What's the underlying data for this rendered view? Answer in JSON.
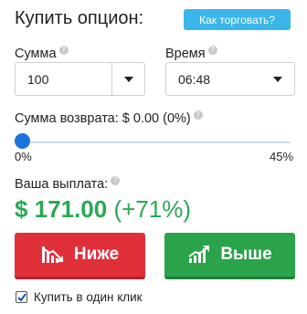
{
  "header": {
    "title": "Купить опцион:",
    "how_to_trade": "Как торговать?"
  },
  "amount": {
    "label": "Сумма",
    "help": "?",
    "value": "100"
  },
  "time": {
    "label": "Время",
    "help": "?",
    "value": "06:48"
  },
  "refund": {
    "label": "Сумма возврата:",
    "value": "$ 0.00 (0%)",
    "help": "?",
    "min": "0%",
    "max": "45%",
    "level_percent": 0
  },
  "payout": {
    "label": "Ваша выплата:",
    "help": "?",
    "amount": "$ 171.00",
    "percent": "(+71%)"
  },
  "buttons": {
    "lower": "Ниже",
    "higher": "Выше"
  },
  "one_click": {
    "label": "Купить в один клик",
    "checked": true
  },
  "colors": {
    "accent_blue": "#3bb6ea",
    "slider_blue": "#1a73d9",
    "payout_green": "#2aa855",
    "lower_red": "#e0303a",
    "higher_green": "#2aa34a"
  }
}
